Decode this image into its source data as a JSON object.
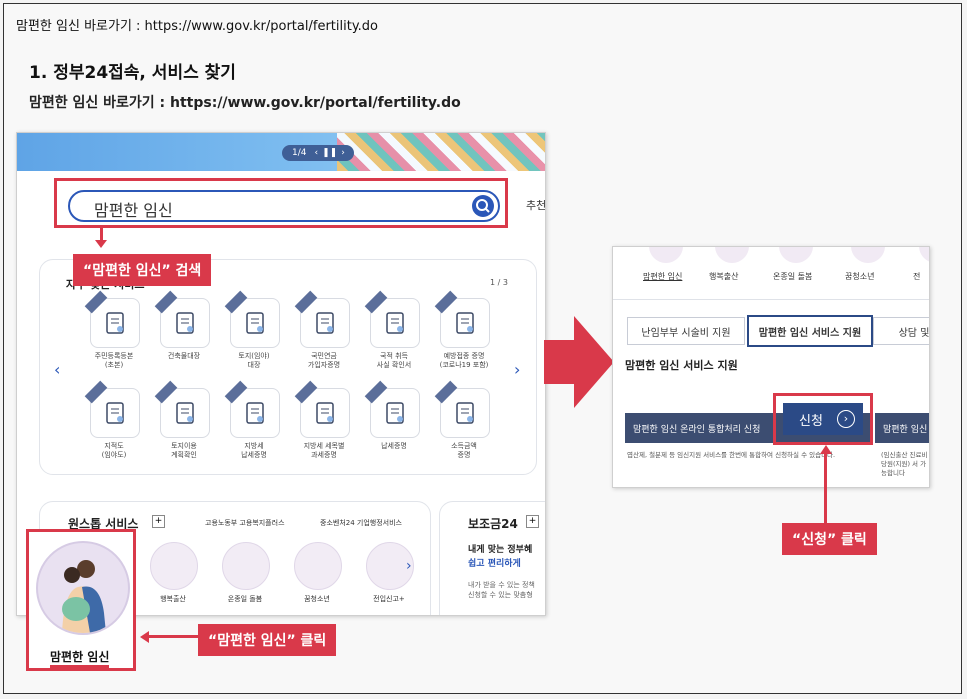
{
  "top_link": "맘편한 임신 바로가기 : https://www.gov.kr/portal/fertility.do",
  "step_heading": "1. 정부24접속, 서비스 찾기",
  "sub_link": "맘편한 임신 바로가기 : https://www.gov.kr/portal/fertility.do",
  "left_shot": {
    "banner_counter": "1/4",
    "search_value": "맘편한 임신",
    "side_label": "추천",
    "services_title": "자주 찾는 서비스",
    "services_page": "1 / 3",
    "icons": [
      {
        "label": "주민등록등본\n(초본)",
        "icon": "id-card-icon"
      },
      {
        "label": "건축물대장",
        "icon": "document-search-icon"
      },
      {
        "label": "토지(임야)\n대장",
        "icon": "land-map-icon"
      },
      {
        "label": "국민연금\n가입자증명",
        "icon": "certificate-icon"
      },
      {
        "label": "국적 취득\n사실 확인서",
        "icon": "passport-icon"
      },
      {
        "label": "예방접종 증명\n(코로나19 포함)",
        "icon": "vaccine-icon"
      },
      {
        "label": "지적도\n(임야도)",
        "icon": "folded-map-icon"
      },
      {
        "label": "토지이용\n계획확인",
        "icon": "location-pin-icon"
      },
      {
        "label": "지방세\n납세증명",
        "icon": "tax-document-icon"
      },
      {
        "label": "지방세 세목별\n과세증명",
        "icon": "presentation-chart-icon"
      },
      {
        "label": "납세증명",
        "icon": "database-icon"
      },
      {
        "label": "소득금액\n증명",
        "icon": "coin-stack-icon"
      }
    ],
    "onestop_title": "원스톱 서비스",
    "onestop_plus": "+",
    "onestop_links": [
      "고용노동부 고용복지플러스",
      "중소벤처24 기업행정서비스"
    ],
    "onestop_circles": [
      "맘편한 임신",
      "행복출산",
      "온종일 돌봄",
      "꿈청소년",
      "전입신고+"
    ],
    "subsidy_title": "보조금24",
    "subsidy_plus": "+",
    "subsidy_line1": "내게 맞는 정부혜",
    "subsidy_line2": "쉽고 편리하게",
    "subsidy_desc1": "내가 받을 수 있는 정책",
    "subsidy_desc2": "신청할 수 있는 맞춤형"
  },
  "callouts": {
    "search": "“맘편한 임신” 검색",
    "click_mom": "“맘편한 임신” 클릭",
    "apply": "“신청” 클릭"
  },
  "zoom_label": "맘편한 임신",
  "right_shot": {
    "top_items": [
      "맘편한 임신",
      "행복출산",
      "온종일 돌봄",
      "꿈청소년",
      "전"
    ],
    "tabs": [
      "난임부부 시술비 지원",
      "맘편한 임신 서비스 지원",
      "상담 및"
    ],
    "section_title": "맘편한 임신 서비스 지원",
    "bar1": "맘편한 임신 온라인 통합처리 신청",
    "bar2": "맘편한 임신",
    "apply_button": "신청",
    "desc_left": "엽산제, 철분제 등 임신지원 서비스를 한번에 통합하여 신청하실 수 있습니다.",
    "desc_right": "(임신출산 진료비 당원(지원) 서 가능합니다"
  },
  "colors": {
    "accent_red": "#d9394a",
    "navy": "#3c4d71",
    "blue": "#2b57b8"
  }
}
